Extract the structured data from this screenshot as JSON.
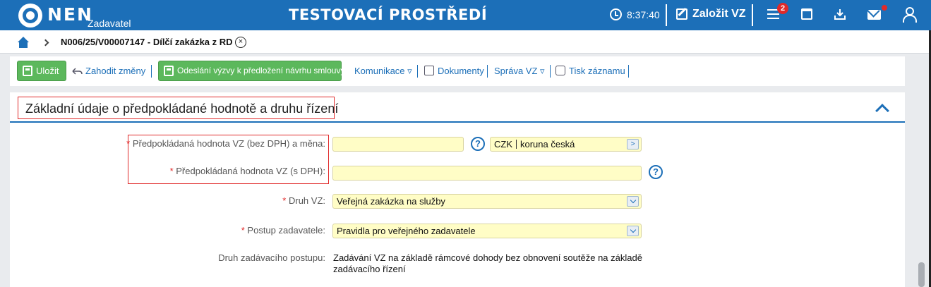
{
  "header": {
    "logo": "NEN",
    "logo_sub": "Zadavatel",
    "env_title": "TESTOVACÍ PROSTŘEDÍ",
    "clock": "8:37:40",
    "create_label": "Založit VZ",
    "badge_count": "2"
  },
  "breadcrumb": {
    "current": "N006/25/V00007147 - Dílčí zakázka z RD",
    "close_glyph": "×"
  },
  "toolbar": {
    "save": "Uložit",
    "discard": "Zahodit změny",
    "send": "Odeslání výzvy k předložení návrhu smlouvy",
    "communication": "Komunikace ▿",
    "documents": "Dokumenty",
    "vz_admin": "Správa VZ ▿",
    "print": "Tisk záznamu"
  },
  "section": {
    "title": "Základní údaje o předpokládané hodnotě a druhu řízení",
    "fields": {
      "value_no_vat": {
        "label": "Předpokládaná hodnota VZ (bez DPH) a měna:",
        "value": ""
      },
      "currency": {
        "code": "CZK",
        "name": "koruna česká"
      },
      "value_with_vat": {
        "label": "Předpokládaná hodnota VZ (s DPH):",
        "value": ""
      },
      "kind": {
        "label": "Druh VZ:",
        "value": "Veřejná zakázka na služby"
      },
      "procedure": {
        "label": "Postup zadavatele:",
        "value": "Pravidla pro veřejného zadavatele"
      },
      "procedure_kind": {
        "label": "Druh zadávacího postupu:",
        "value": "Zadávání VZ na základě rámcové dohody bez obnovení soutěže na základě zadávacího řízení"
      }
    },
    "required_mark": "*",
    "help_glyph": "?"
  },
  "colors": {
    "brand": "#1c6fb8",
    "save_green": "#5cb85c",
    "highlight_red": "#e02a2a",
    "field_yellow": "#fffdc6"
  }
}
